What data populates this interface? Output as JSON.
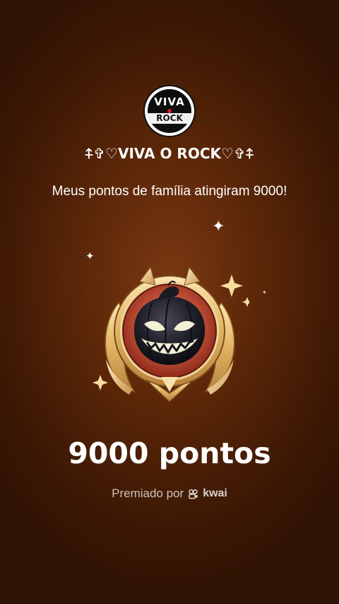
{
  "family": {
    "avatar": {
      "logo_text_top": "VIVA",
      "logo_text_bottom": "ROCK"
    },
    "name": "⍏✞♡VIVA O ROCK♡✞⍏"
  },
  "message": "Meus pontos de família atingiram 9000!",
  "reward": {
    "badge_icon": "pumpkin-venom-badge",
    "points_label": "9000 pontos"
  },
  "awarded_by": {
    "prefix": "Premiado por",
    "brand": "kwai",
    "brand_icon": "kwai-logo-icon"
  },
  "colors": {
    "background_center": "#7a3812",
    "background_edge": "#2e1203",
    "gold": "#e8c27a",
    "text_secondary": "rgba(255,255,255,0.72)"
  }
}
